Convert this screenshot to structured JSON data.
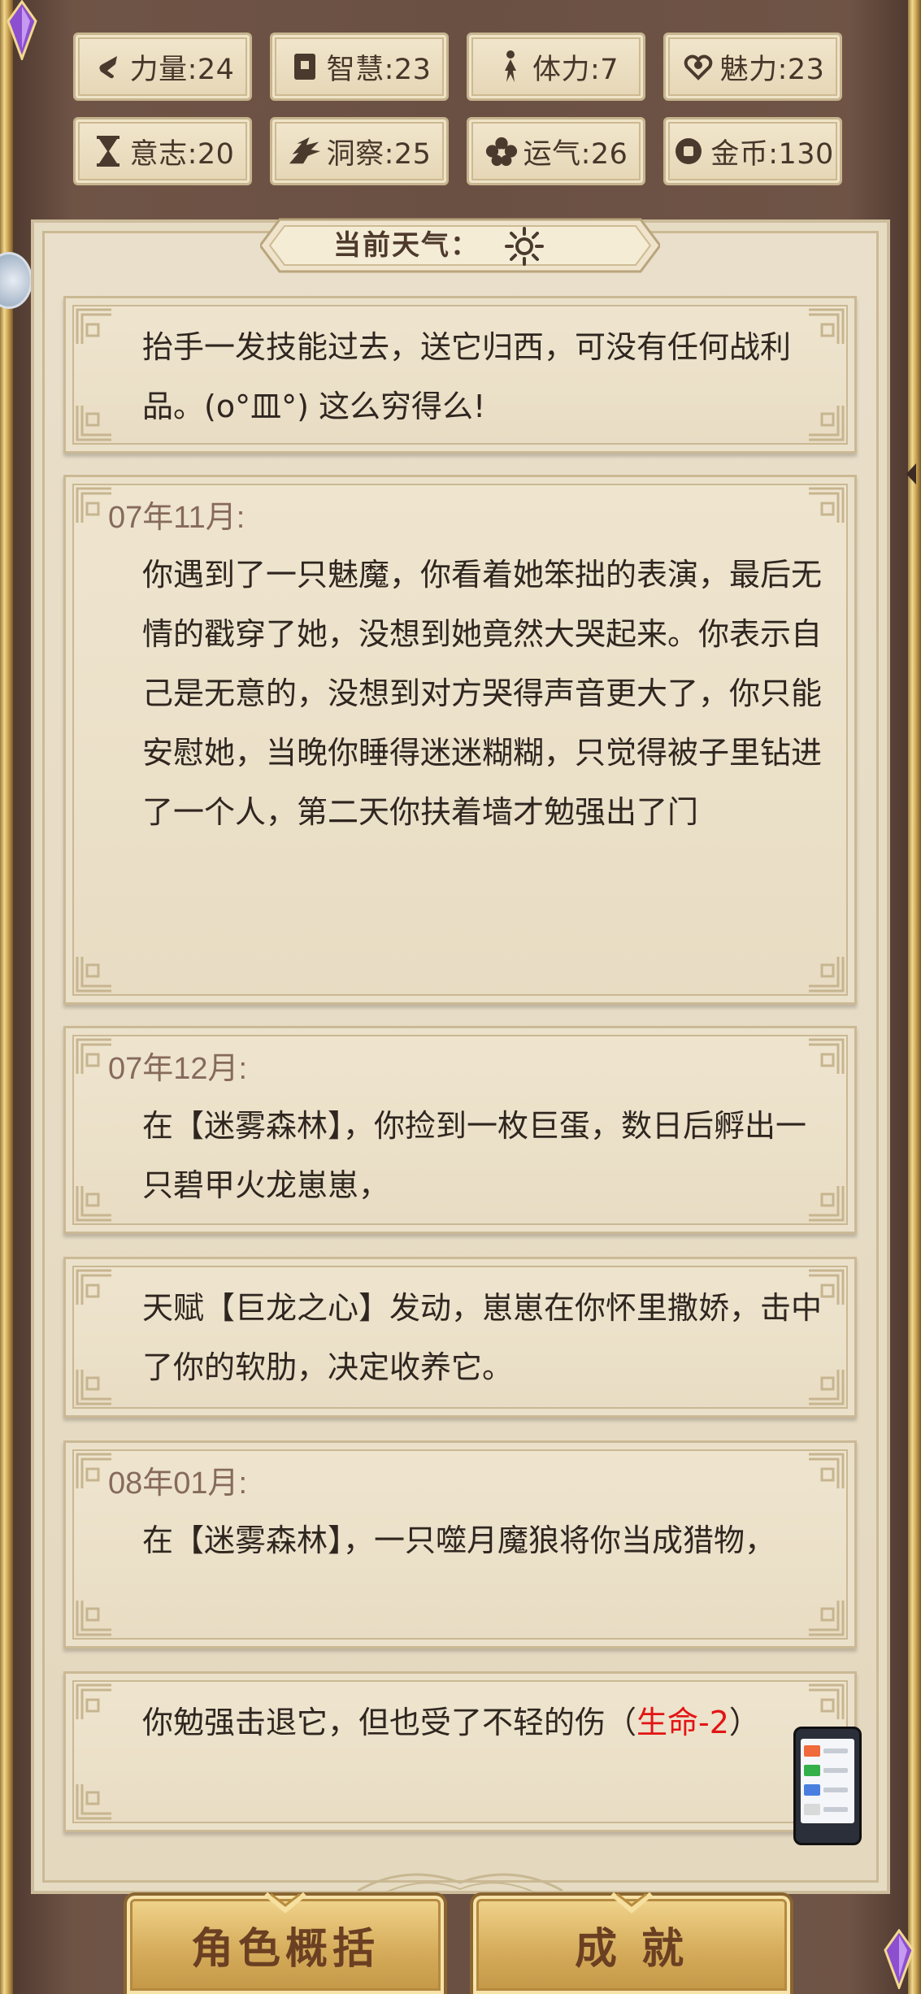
{
  "stats": [
    {
      "label": "力量",
      "value": "24",
      "icon": "fist-icon"
    },
    {
      "label": "智慧",
      "value": "23",
      "icon": "book-icon"
    },
    {
      "label": "体力",
      "value": "7",
      "icon": "runner-icon"
    },
    {
      "label": "魅力",
      "value": "23",
      "icon": "heart-swirl-icon"
    },
    {
      "label": "意志",
      "value": "20",
      "icon": "hourglass-icon"
    },
    {
      "label": "洞察",
      "value": "25",
      "icon": "eagle-icon"
    },
    {
      "label": "运气",
      "value": "26",
      "icon": "clover-icon"
    },
    {
      "label": "金币",
      "value": "130",
      "icon": "coin-icon"
    }
  ],
  "weather": {
    "label": "当前天气：",
    "icon": "sun-icon"
  },
  "log": [
    {
      "date": "",
      "text": "抬手一发技能过去，送它归西，可没有任何战利品。(o°皿°) 这么穷得么!"
    },
    {
      "date": "07年11月:",
      "text": "你遇到了一只魅魔，你看着她笨拙的表演，最后无情的戳穿了她，没想到她竟然大哭起来。你表示自己是无意的，没想到对方哭得声音更大了，你只能安慰她，当晚你睡得迷迷糊糊，只觉得被子里钻进了一个人，第二天你扶着墙才勉强出了门"
    },
    {
      "date": "07年12月:",
      "text": "在【迷雾森林】，你捡到一枚巨蛋，数日后孵出一只碧甲火龙崽崽，"
    },
    {
      "date": "",
      "text": "天赋【巨龙之心】发动，崽崽在你怀里撒娇，击中了你的软肋，决定收养它。"
    },
    {
      "date": "08年01月:",
      "text": "在【迷雾森林】，一只噬月魔狼将你当成猎物，"
    },
    {
      "date": "",
      "text": "你勉强击退它，但也受了不轻的伤（",
      "highlight": "生命-2",
      "text_after": "）"
    }
  ],
  "buttons": {
    "summary": "角色概括",
    "achievements": "成 就"
  },
  "colors": {
    "accent_red": "#e21414",
    "frame_brown": "#5e463a",
    "parchment": "#e9dfca",
    "gold": "#d6ad5c"
  }
}
